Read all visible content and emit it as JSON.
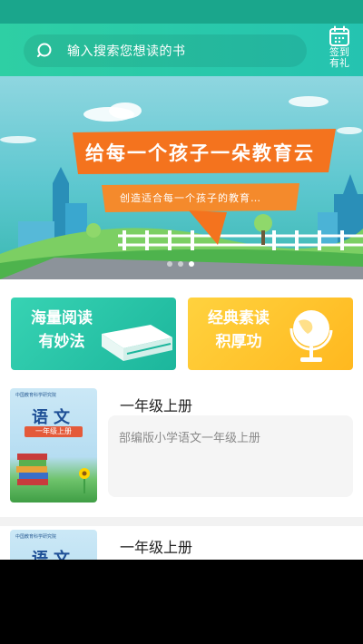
{
  "search": {
    "placeholder": "输入搜索您想读的书"
  },
  "checkin": {
    "label_line1": "签到",
    "label_line2": "有礼"
  },
  "banner": {
    "title": "给每一个孩子一朵教育云",
    "subtitle": "创造适合每一个孩子的教育…",
    "page_count": 3,
    "active_page": 3
  },
  "features": [
    {
      "line1": "海量阅读",
      "line2": "有妙法",
      "icon": "book-icon",
      "color": "#22bfa2"
    },
    {
      "line1": "经典素读",
      "line2": "积厚功",
      "icon": "globe-icon",
      "color": "#ffc22e"
    }
  ],
  "books": [
    {
      "title": "一年级上册",
      "description": "部编版小学语文一年级上册",
      "cover": {
        "publisher": "中国教育科学研究院",
        "subject": "语文",
        "grade": "一年级上册"
      }
    },
    {
      "title": "一年级上册",
      "description": "",
      "cover": {
        "publisher": "中国教育科学研究院",
        "subject": "语文",
        "grade": ""
      }
    }
  ],
  "colors": {
    "accent": "#25c3b0",
    "banner_orange": "#f4731e",
    "card_yellow": "#ffc22e"
  }
}
